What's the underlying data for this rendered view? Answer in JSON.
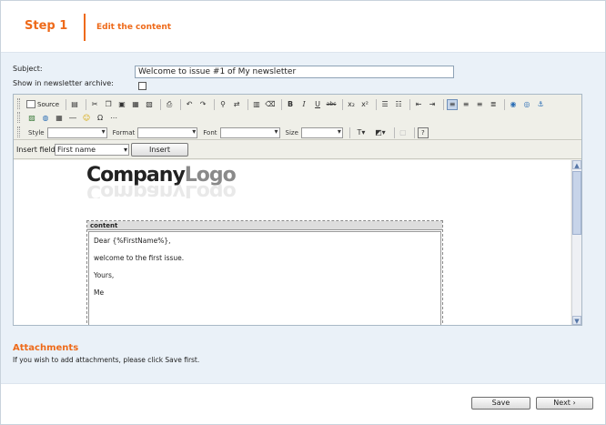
{
  "header": {
    "step": "Step 1",
    "title": "Edit the content"
  },
  "form": {
    "subject_label": "Subject:",
    "subject_value": "Welcome to issue #1 of My newsletter",
    "archive_label": "Show in newsletter archive:"
  },
  "toolbar": {
    "source_label": "Source",
    "style_label": "Style",
    "format_label": "Format",
    "font_label": "Font",
    "size_label": "Size"
  },
  "insert": {
    "label": "Insert field:",
    "selected": "First name",
    "button": "Insert"
  },
  "document": {
    "logo_part1": "Company",
    "logo_part2": "Logo",
    "region_title": "content",
    "lines": [
      "Dear {%FirstName%},",
      "welcome to the first issue.",
      "Yours,",
      "Me"
    ]
  },
  "attachments": {
    "title": "Attachments",
    "note": "If you wish to add attachments, please click Save first."
  },
  "footer": {
    "save": "Save",
    "next": "Next ›"
  },
  "colors": {
    "accent": "#ee6a1a",
    "panel": "#eaf1f8"
  }
}
